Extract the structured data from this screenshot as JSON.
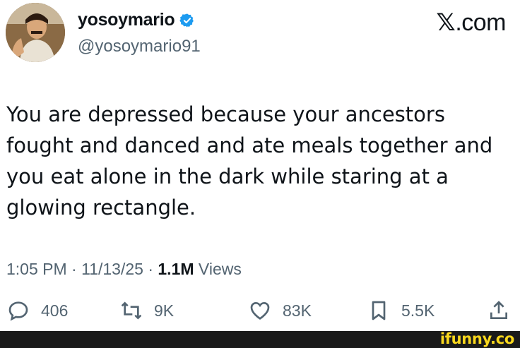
{
  "header": {
    "display_name": "yosoymario",
    "handle": "@yosoymario91",
    "site_prefix": "𝕏",
    "site_suffix": ".com"
  },
  "tweet": {
    "text_lines": [
      "You are depressed because your ancestors",
      "fought and danced and ate meals together and",
      "you eat alone in the dark while staring at a",
      "glowing rectangle."
    ]
  },
  "meta": {
    "time": "1:05 PM",
    "sep1": " · ",
    "date": "11/13/25",
    "sep2": " · ",
    "views_count": "1.1M",
    "views_label": " Views"
  },
  "actions": {
    "replies": "406",
    "retweets": "9K",
    "likes": "83K",
    "bookmarks": "5.5K"
  },
  "icons": {
    "reply": "speech-bubble-icon",
    "retweet": "retweet-arrows-icon",
    "like": "heart-icon",
    "bookmark": "bookmark-icon",
    "share": "share-upload-icon",
    "verified": "verified-badge-icon"
  },
  "colors": {
    "verified_blue": "#1d9bf0",
    "secondary_text": "#536471",
    "primary_text": "#0f1419",
    "watermark": "#f9d71c"
  },
  "watermark": "ifunny.co"
}
